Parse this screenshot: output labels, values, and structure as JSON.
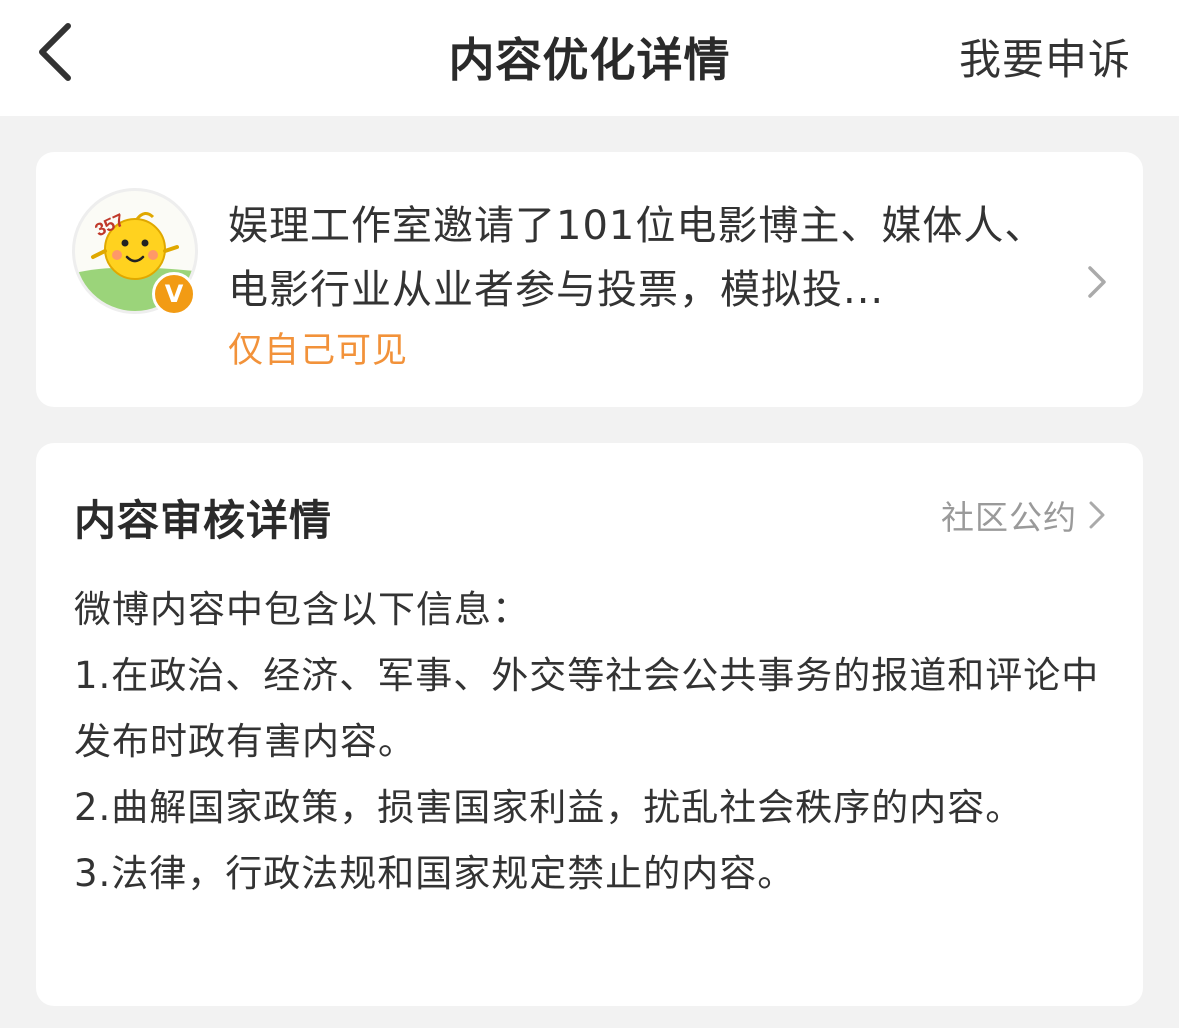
{
  "nav": {
    "title": "内容优化详情",
    "appeal_label": "我要申诉"
  },
  "post": {
    "text": "娱理工作室邀请了101位电影博主、媒体人、电影行业从业者参与投票，模拟投...",
    "visibility": "仅自己可见",
    "avatar_label": "357",
    "verified_badge": "V"
  },
  "detail": {
    "title": "内容审核详情",
    "community_link": "社区公约",
    "lines": [
      "微博内容中包含以下信息：",
      "1.在政治、经济、军事、外交等社会公共事务的报道和评论中发布时政有害内容。",
      "2.曲解国家政策，损害国家利益，扰乱社会秩序的内容。",
      "3.法律，行政法规和国家规定禁止的内容。"
    ]
  },
  "colors": {
    "accent_orange": "#f2923a",
    "badge_orange": "#f29b14",
    "background": "#f2f2f2",
    "muted_text": "#9a9a9a"
  }
}
